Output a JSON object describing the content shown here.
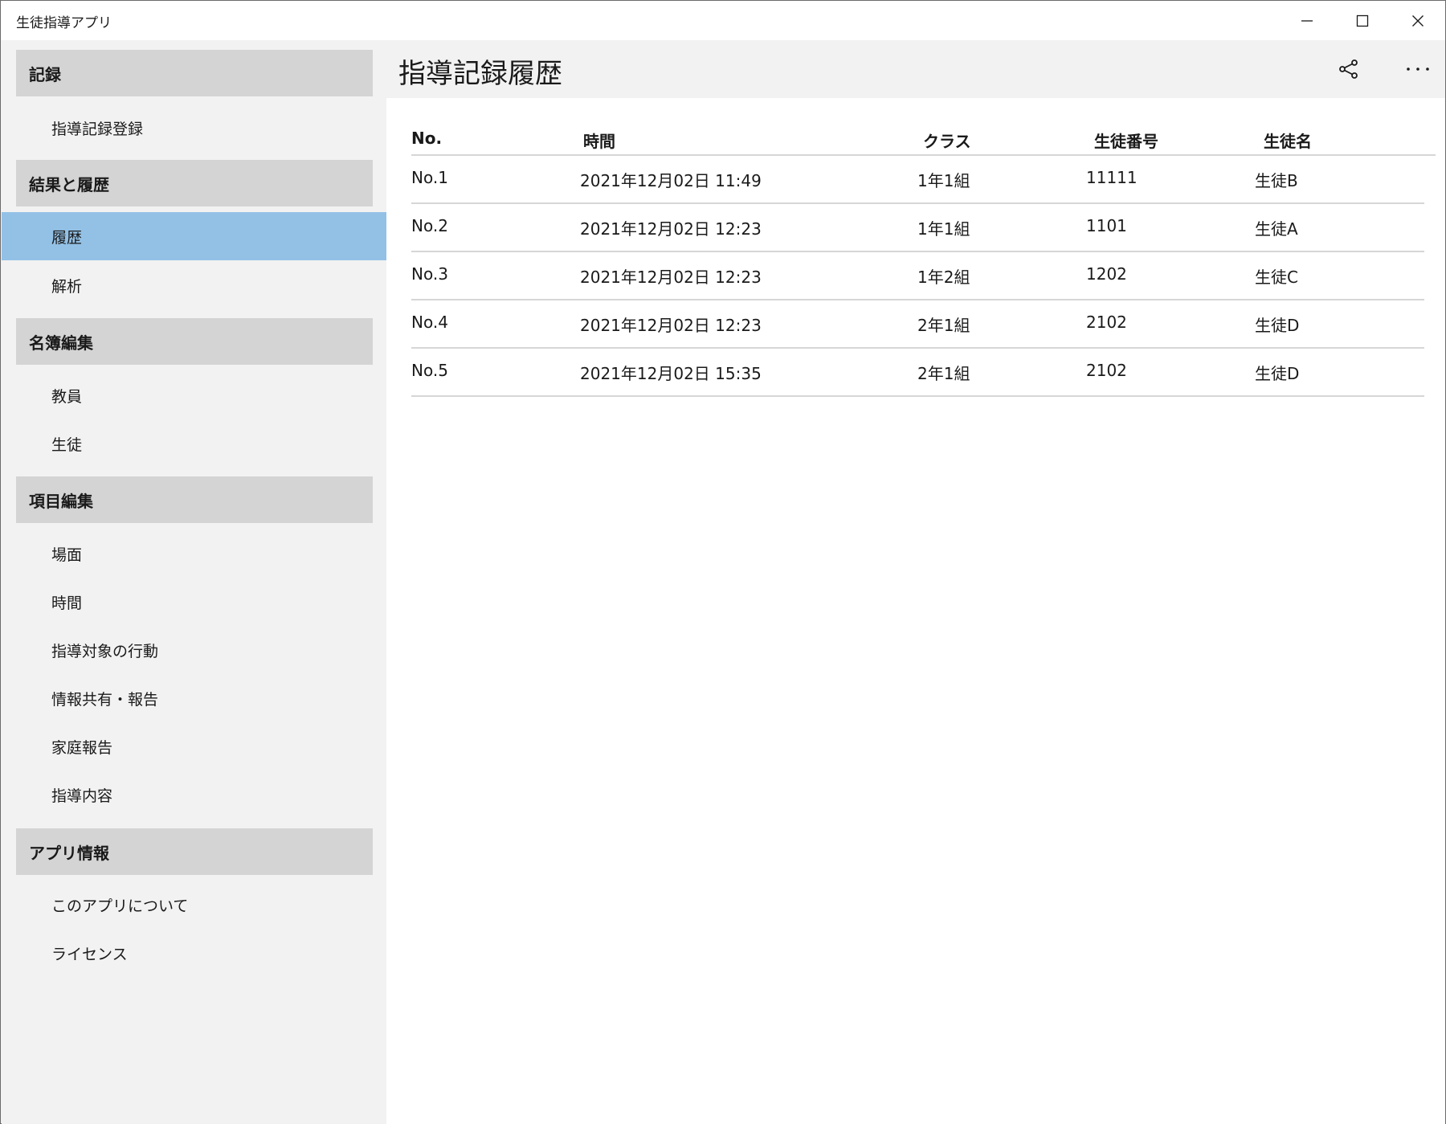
{
  "window": {
    "title": "生徒指導アプリ"
  },
  "sidebar": {
    "groups": [
      {
        "header": "記録",
        "items": [
          "指導記録登録"
        ]
      },
      {
        "header": "結果と履歴",
        "items": [
          "履歴",
          "解析"
        ]
      },
      {
        "header": "名簿編集",
        "items": [
          "教員",
          "生徒"
        ]
      },
      {
        "header": "項目編集",
        "items": [
          "場面",
          "時間",
          "指導対象の行動",
          "情報共有・報告",
          "家庭報告",
          "指導内容"
        ]
      },
      {
        "header": "アプリ情報",
        "items": [
          "このアプリについて",
          "ライセンス"
        ]
      }
    ],
    "selected_item": "履歴"
  },
  "main": {
    "title": "指導記録履歴",
    "table": {
      "columns": [
        "No.",
        "時間",
        "クラス",
        "生徒番号",
        "生徒名"
      ],
      "rows": [
        [
          "No.1",
          "2021年12月02日 11:49",
          "1年1組",
          "11111",
          "生徒B"
        ],
        [
          "No.2",
          "2021年12月02日 12:23",
          "1年1組",
          "1101",
          "生徒A"
        ],
        [
          "No.3",
          "2021年12月02日 12:23",
          "1年2組",
          "1202",
          "生徒C"
        ],
        [
          "No.4",
          "2021年12月02日 12:23",
          "2年1組",
          "2102",
          "生徒D"
        ],
        [
          "No.5",
          "2021年12月02日 15:35",
          "2年1組",
          "2102",
          "生徒D"
        ]
      ]
    }
  },
  "colors": {
    "selected": "#93c1e6",
    "group_header": "#d4d4d4",
    "pane_background": "#f2f2f2",
    "content_background": "#ffffff"
  },
  "icons": {
    "minimize": "minimize-icon",
    "maximize": "maximize-icon",
    "close": "close-icon",
    "share": "share-icon",
    "more": "more-icon"
  }
}
